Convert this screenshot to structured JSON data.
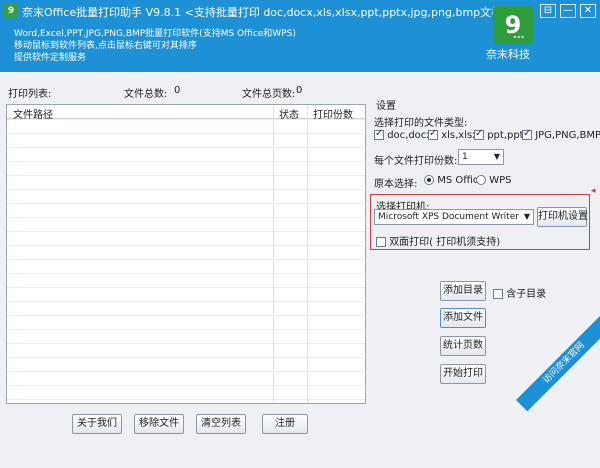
{
  "window": {
    "title": "奈末Office批量打印助手  V9.8.1  <支持批量打印 doc,docx,xls,xlsx,ppt,pptx,jpg,png,bmp文档>",
    "app_icon": "9",
    "desc_lines": [
      "Word,Excel,PPT,JPG,PNG,BMP批量打印软件(支持MS Office和WPS)",
      "移动鼠标到软件列表,点击鼠标右键可对其排序",
      "提供软件定制服务"
    ],
    "brand_logo": "9",
    "brand_dots": "...",
    "brand_name": "奈末科技",
    "controls": {
      "pin": "⊟",
      "minimize": "—",
      "close": "✕"
    },
    "accent_color": "#1e91d6"
  },
  "list": {
    "title": "打印列表:",
    "total_files_label": "文件总数:",
    "total_files": "0",
    "total_pages_label": "文件总页数:",
    "total_pages": "0",
    "columns": [
      "文件路径",
      "状态",
      "打印份数"
    ],
    "rows": []
  },
  "bottom_buttons": {
    "about": "关于我们",
    "remove": "移除文件",
    "clear": "清空列表",
    "register": "注册"
  },
  "settings": {
    "title": "设置",
    "file_types_label": "选择打印的文件类型:",
    "file_types": [
      {
        "label": "doc,docx",
        "checked": true
      },
      {
        "label": "xls,xlsx",
        "checked": true
      },
      {
        "label": "ppt,pptx",
        "checked": true
      },
      {
        "label": "JPG,PNG,BMP",
        "checked": true
      }
    ],
    "copies_label": "每个文件打印份数:",
    "copies_value": "1",
    "version_label": "原本选择:",
    "version_options": [
      {
        "label": "MS Office",
        "selected": true
      },
      {
        "label": "WPS",
        "selected": false
      }
    ],
    "printer_label": "选择打印机:",
    "printer_value": "Microsoft XPS Document Writer",
    "printer_settings": "打印机设置",
    "duplex_label": "双面打印( 打印机须支持)",
    "duplex_checked": false
  },
  "actions": {
    "add_folder": "添加目录",
    "include_subfolders": "含子目录",
    "include_subfolders_checked": false,
    "add_file": "添加文件",
    "count_pages": "统计页数",
    "start_print": "开始打印"
  },
  "ribbon": "访问奈末官网"
}
